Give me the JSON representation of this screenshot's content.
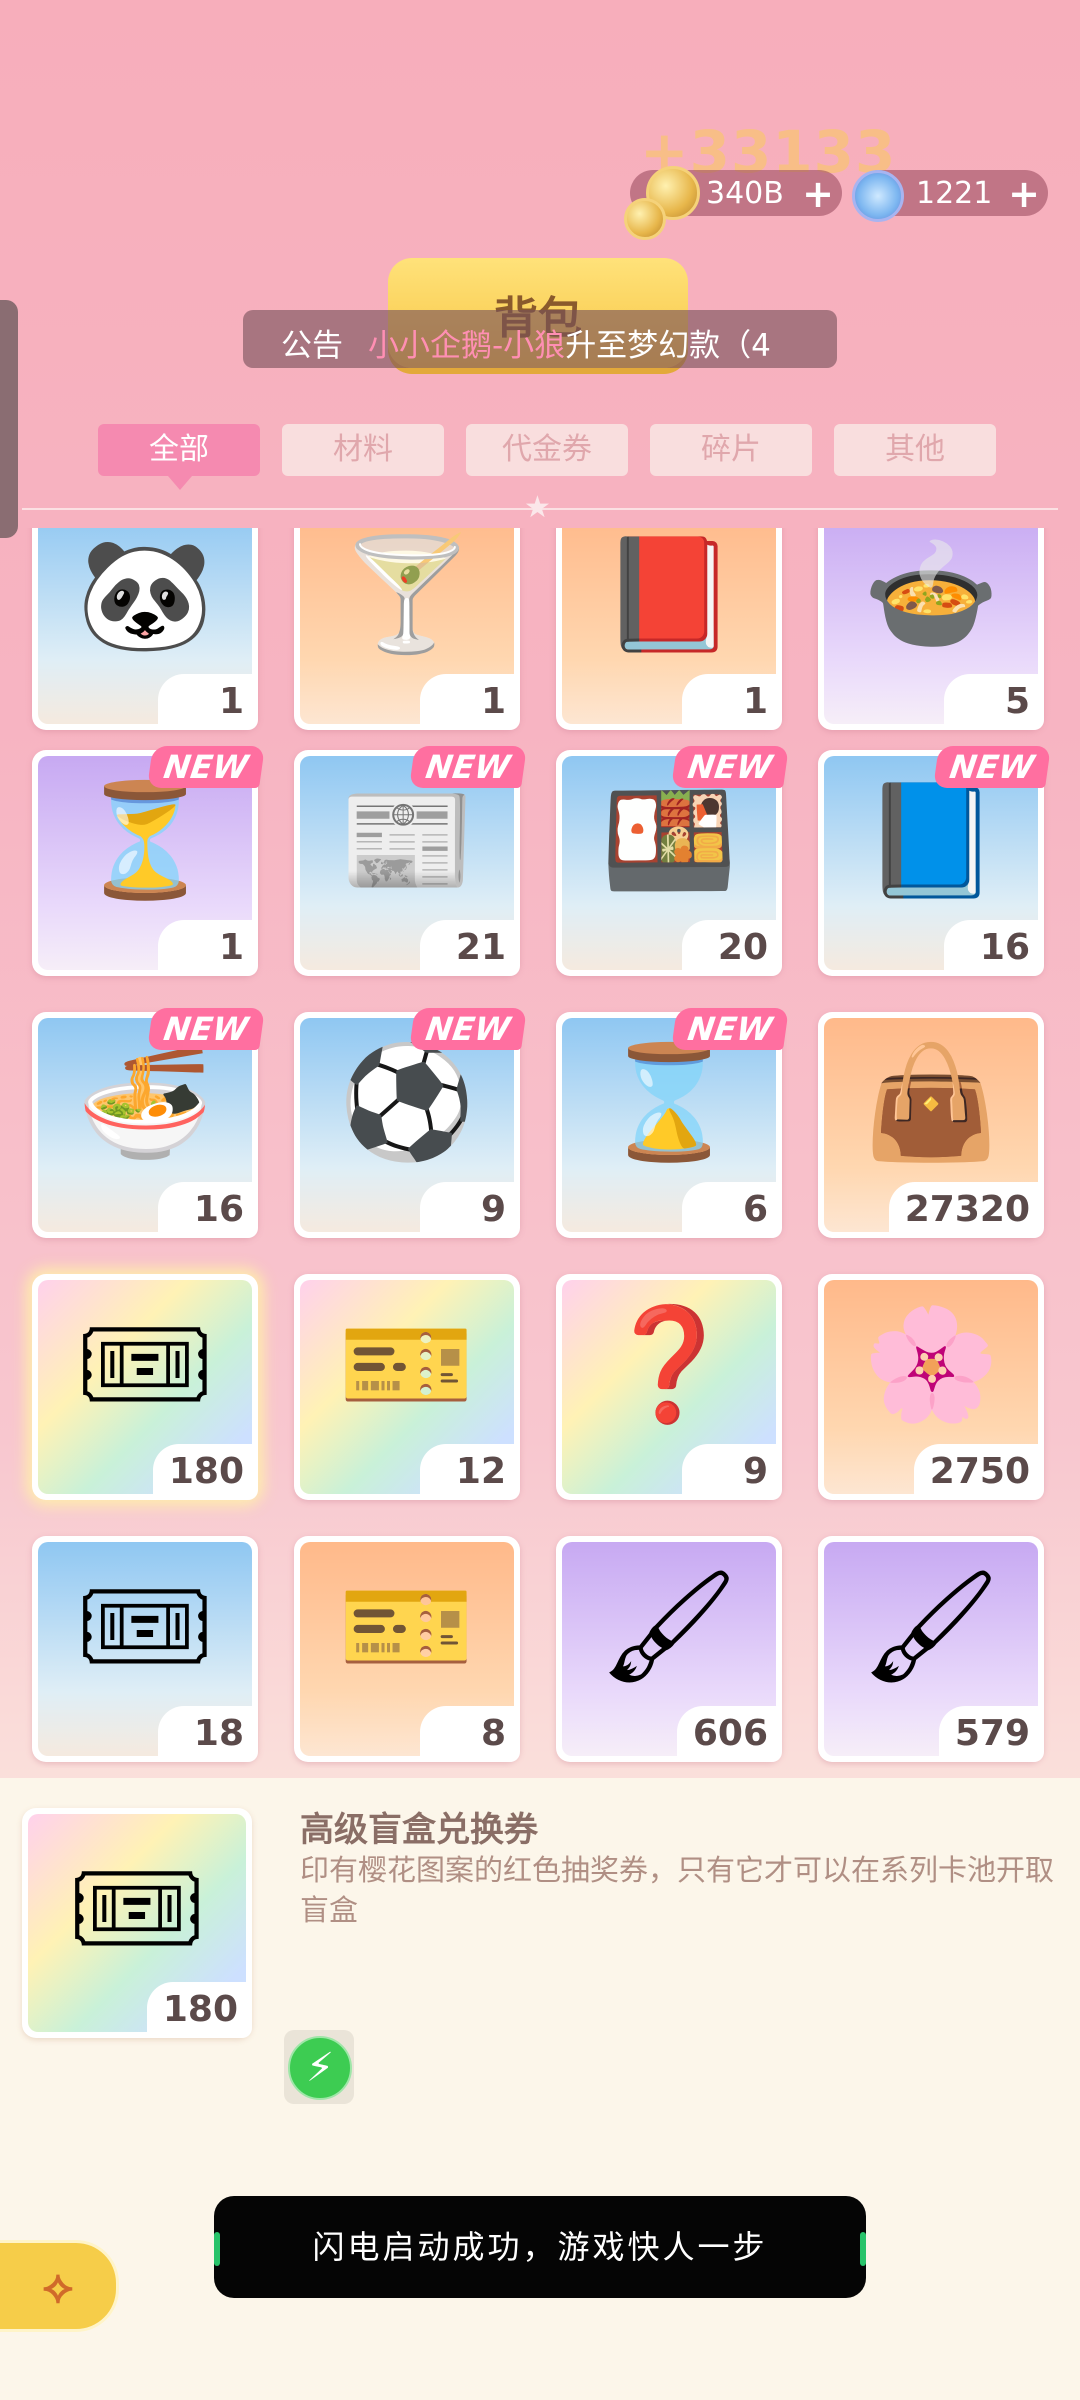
{
  "currency": {
    "gain": "+33133",
    "coins": "340B",
    "gems": "1221",
    "add_symbol": "+"
  },
  "header": {
    "title": "背包",
    "notice_label": "公告",
    "notice_highlight": "小小企鹅-小狼",
    "notice_text": "升至梦幻款（4"
  },
  "tabs": [
    {
      "label": "全部",
      "active": true
    },
    {
      "label": "材料",
      "active": false
    },
    {
      "label": "代金券",
      "active": false
    },
    {
      "label": "碎片",
      "active": false
    },
    {
      "label": "其他",
      "active": false
    }
  ],
  "items": [
    {
      "icon": "panda-plush-icon",
      "glyph": "🐼",
      "count": "1",
      "bg": "bg-blue",
      "new": ""
    },
    {
      "icon": "blue-drink-penguin-icon",
      "glyph": "🍸",
      "count": "1",
      "bg": "bg-orange",
      "new": ""
    },
    {
      "icon": "music-notebook-icon",
      "glyph": "📕",
      "count": "1",
      "bg": "bg-orange",
      "new": ""
    },
    {
      "icon": "mapo-tofu-icon",
      "glyph": "🍲",
      "count": "5",
      "bg": "bg-purple",
      "new": ""
    },
    {
      "icon": "blue-hourglass-icon",
      "glyph": "⏳",
      "count": "1",
      "bg": "bg-purple",
      "new": "NEW"
    },
    {
      "icon": "newspaper-icon",
      "glyph": "📰",
      "count": "21",
      "bg": "bg-blue",
      "new": "NEW"
    },
    {
      "icon": "bento-box-icon",
      "glyph": "🍱",
      "count": "20",
      "bg": "bg-blue",
      "new": "NEW"
    },
    {
      "icon": "magnifier-book-icon",
      "glyph": "📘",
      "count": "16",
      "bg": "bg-blue",
      "new": "NEW"
    },
    {
      "icon": "ramen-bowl-icon",
      "glyph": "🍜",
      "count": "16",
      "bg": "bg-blue",
      "new": "NEW"
    },
    {
      "icon": "soccer-ball-icon",
      "glyph": "⚽",
      "count": "9",
      "bg": "bg-blue",
      "new": "NEW"
    },
    {
      "icon": "green-hourglass-icon",
      "glyph": "⌛",
      "count": "6",
      "bg": "bg-blue",
      "new": "NEW"
    },
    {
      "icon": "pink-bag-coin-icon",
      "glyph": "👜",
      "count": "27320",
      "bg": "bg-orange",
      "new": ""
    },
    {
      "icon": "sakura-ticket-icon",
      "glyph": "🎟",
      "count": "180",
      "bg": "bg-rainbow",
      "new": "",
      "selected": true
    },
    {
      "icon": "rainbow-avatar-ticket-icon",
      "glyph": "🎫",
      "count": "12",
      "bg": "bg-rainbow",
      "new": ""
    },
    {
      "icon": "mystery-ticket-icon",
      "glyph": "❓",
      "count": "9",
      "bg": "bg-rainbow",
      "new": ""
    },
    {
      "icon": "cherry-blossom-icon",
      "glyph": "🌸",
      "count": "2750",
      "bg": "bg-orange",
      "new": ""
    },
    {
      "icon": "blue-wave-ticket-icon",
      "glyph": "🎟",
      "count": "18",
      "bg": "bg-blue",
      "new": ""
    },
    {
      "icon": "bag-ticket-icon",
      "glyph": "🎫",
      "count": "8",
      "bg": "bg-orange",
      "new": ""
    },
    {
      "icon": "green-paint-roller-icon",
      "glyph": "🖌",
      "count": "606",
      "bg": "bg-purple",
      "new": ""
    },
    {
      "icon": "pink-paint-roller-icon",
      "glyph": "🖌",
      "count": "579",
      "bg": "bg-purple",
      "new": ""
    }
  ],
  "detail": {
    "icon": "sakura-ticket-icon",
    "glyph": "🎟",
    "count": "180",
    "name": "高级盲盒兑换券",
    "description": "印有樱花图案的红色抽奖券，只有它才可以在系列卡池开取盲盒"
  },
  "toast": "闪电启动成功，游戏快人一步",
  "flash_symbol": "⚡",
  "back_symbol": "⟡"
}
